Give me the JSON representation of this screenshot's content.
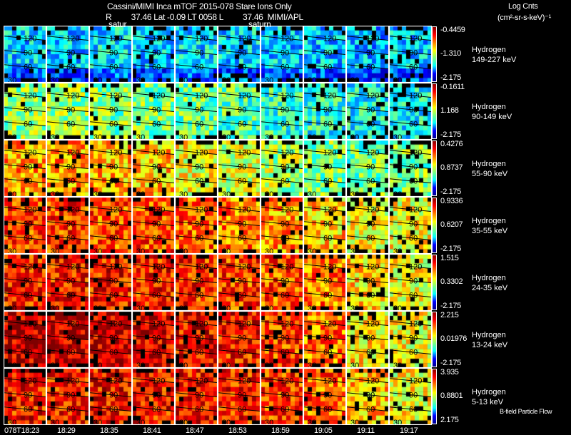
{
  "header": {
    "title_line1": "Cassini/MIMI Inca mTOF  2015-078   Stare   Ions Only",
    "title_line2": "R         37.46 Lat -0.09 LT 0058 L         37.46  MIMI/APL",
    "units_line1": "Log Cnts",
    "units_line2": "(cm²-sr-s-keV)⁻¹"
  },
  "saturn_labels": [
    "satur",
    "saturn"
  ],
  "footer_note": "B-field Particle Flow",
  "chart_data": {
    "type": "heatmap",
    "colormap": "jet",
    "missing_color": "#000000",
    "times": [
      "078T18:23",
      "18:29",
      "18:35",
      "18:41",
      "18:47",
      "18:53",
      "18:59",
      "19:05",
      "19:11",
      "19:17"
    ],
    "contour_levels": [
      "120",
      "90",
      "60",
      "30"
    ],
    "rows": [
      {
        "species": "Hydrogen",
        "energy": "149-227 keV",
        "cb_max": "-0.4459",
        "cb_mid": "-1.310",
        "cb_min": "-2.175",
        "levels": [
          0.33,
          0.32,
          0.35,
          0.33,
          0.35,
          0.34,
          0.33,
          0.32,
          0.3,
          0.32
        ]
      },
      {
        "species": "Hydrogen",
        "energy": "90-149 keV",
        "cb_max": "-0.1611",
        "cb_mid": "1.168",
        "cb_min": "-2.175",
        "levels": [
          0.52,
          0.52,
          0.5,
          0.5,
          0.48,
          0.45,
          0.42,
          0.4,
          0.38,
          0.38
        ]
      },
      {
        "species": "Hydrogen",
        "energy": "55-90 keV",
        "cb_max": "0.4276",
        "cb_mid": "0.8737",
        "cb_min": "-2.175",
        "levels": [
          0.72,
          0.72,
          0.7,
          0.68,
          0.62,
          0.58,
          0.55,
          0.5,
          0.48,
          0.5
        ]
      },
      {
        "species": "Hydrogen",
        "energy": "35-55 keV",
        "cb_max": "0.9336",
        "cb_mid": "0.6207",
        "cb_min": "-2.175",
        "levels": [
          0.82,
          0.82,
          0.8,
          0.8,
          0.78,
          0.75,
          0.72,
          0.68,
          0.62,
          0.62
        ]
      },
      {
        "species": "Hydrogen",
        "energy": "24-35 keV",
        "cb_max": "1.515",
        "cb_mid": "0.3302",
        "cb_min": "-2.175",
        "levels": [
          0.86,
          0.86,
          0.86,
          0.85,
          0.84,
          0.82,
          0.8,
          0.76,
          0.66,
          0.62
        ]
      },
      {
        "species": "Hydrogen",
        "energy": "13-24 keV",
        "cb_max": "2.215",
        "cb_mid": "0.01976",
        "cb_min": "-2.175",
        "levels": [
          0.94,
          0.94,
          0.93,
          0.9,
          0.88,
          0.86,
          0.82,
          0.76,
          0.66,
          0.62
        ]
      },
      {
        "species": "Hydrogen",
        "energy": "5-13 keV",
        "cb_max": "3.935",
        "cb_mid": "0.8801",
        "cb_min": "2.175",
        "levels": [
          0.86,
          0.86,
          0.87,
          0.86,
          0.86,
          0.85,
          0.82,
          0.78,
          0.68,
          0.62
        ]
      }
    ]
  }
}
